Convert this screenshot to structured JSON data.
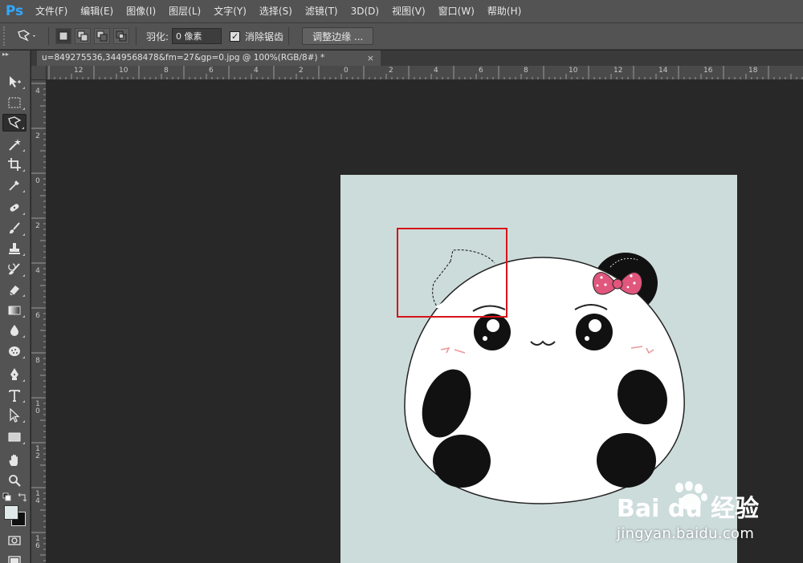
{
  "app": {
    "logo": "Ps"
  },
  "menu": [
    "文件(F)",
    "编辑(E)",
    "图像(I)",
    "图层(L)",
    "文字(Y)",
    "选择(S)",
    "滤镜(T)",
    "3D(D)",
    "视图(V)",
    "窗口(W)",
    "帮助(H)"
  ],
  "options": {
    "feather_label": "羽化:",
    "feather_value": "0 像素",
    "antialias_label": "消除锯齿",
    "antialias_checked": true,
    "refine_edge_label": "调整边缘 ..."
  },
  "toolbar": {
    "collapse_glyph": "▸▸"
  },
  "document": {
    "tab_title": "u=849275536,3449568478&fm=27&gp=0.jpg @ 100%(RGB/8#) *",
    "close_glyph": "×"
  },
  "ruler_h_labels": [
    "12",
    "10",
    "8",
    "6",
    "4",
    "2",
    "0",
    "2",
    "4",
    "6",
    "8",
    "10",
    "12",
    "14",
    "16",
    "18"
  ],
  "ruler_v_labels": [
    "4",
    "2",
    "0",
    "2",
    "4",
    "6",
    "8",
    "1 0",
    "1 2",
    "1 4",
    "1 6"
  ],
  "watermark": {
    "brand": "Bai du 经验",
    "url": "jingyan.baidu.com"
  },
  "colors": {
    "accent": "#31a8ff",
    "canvas_bg": "#ccdcdb",
    "highlight": "#d6141a",
    "bow": "#e0567c"
  }
}
